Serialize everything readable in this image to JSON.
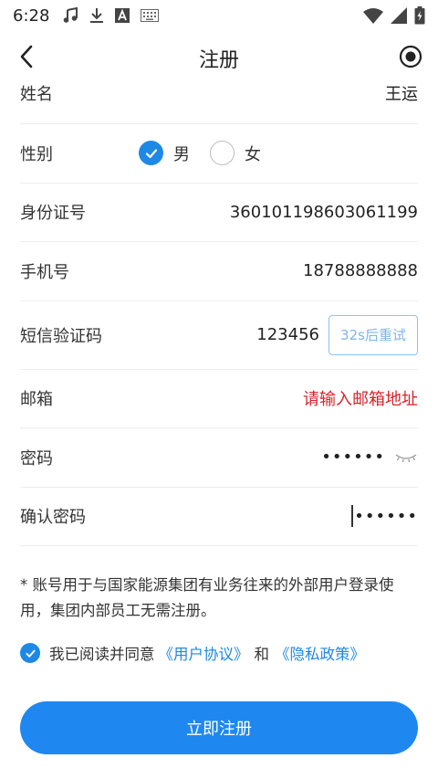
{
  "status_bar": {
    "time": "6:28",
    "icons_left": [
      "music-icon",
      "download-icon",
      "font-a-icon",
      "keyboard-icon"
    ],
    "icons_right": [
      "wifi-icon",
      "signal-icon",
      "battery-charging-icon"
    ]
  },
  "nav": {
    "title": "注册",
    "back_icon": "chevron-left-icon",
    "right_icon": "record-icon"
  },
  "form": {
    "name": {
      "label": "姓名",
      "value": "王运"
    },
    "gender": {
      "label": "性别",
      "options": [
        {
          "label": "男",
          "checked": true
        },
        {
          "label": "女",
          "checked": false
        }
      ]
    },
    "id_number": {
      "label": "身份证号",
      "value": "360101198603061199"
    },
    "phone": {
      "label": "手机号",
      "value": "18788888888"
    },
    "sms_code": {
      "label": "短信验证码",
      "value": "123456",
      "button_label": "32s后重试"
    },
    "email": {
      "label": "邮箱",
      "placeholder": "请输入邮箱地址"
    },
    "password": {
      "label": "密码",
      "value": "••••••"
    },
    "confirm_password": {
      "label": "确认密码",
      "value": "••••••"
    }
  },
  "note": "* 账号用于与国家能源集团有业务往来的外部用户登录使用，集团内部员工无需注册。",
  "agreement": {
    "checked": true,
    "prefix": "我已阅读并同意",
    "link_user": "《用户协议》",
    "and": "和",
    "link_privacy": "《隐私政策》"
  },
  "submit_label": "立即注册",
  "colors": {
    "accent": "#1e88e5",
    "error_placeholder": "#d8232a",
    "code_button": "#7fb6e9"
  }
}
